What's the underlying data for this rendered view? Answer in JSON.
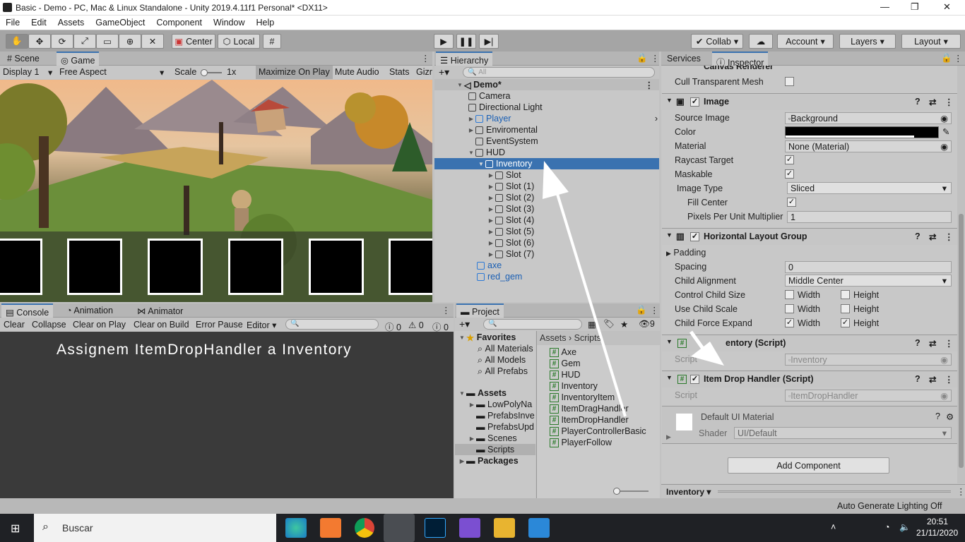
{
  "window": {
    "title": "Basic - Demo - PC, Mac & Linux Standalone - Unity 2019.4.11f1 Personal* <DX11>"
  },
  "menu": [
    "File",
    "Edit",
    "Assets",
    "GameObject",
    "Component",
    "Window",
    "Help"
  ],
  "toolbar": {
    "center": "Center",
    "local": "Local",
    "collab": "Collab",
    "account": "Account",
    "layers": "Layers",
    "layout": "Layout"
  },
  "scene_panel": {
    "tabs": [
      "Scene",
      "Game"
    ],
    "display": "Display 1",
    "aspect": "Free Aspect",
    "scale_label": "Scale",
    "scale_value": "1x",
    "buttons": [
      "Maximize On Play",
      "Mute Audio",
      "Stats",
      "Gizr"
    ]
  },
  "hierarchy": {
    "tab": "Hierarchy",
    "search_placeholder": "All",
    "scene": "Demo*",
    "items": [
      "Camera",
      "Directional Light",
      "Player",
      "Enviromental",
      "EventSystem",
      "HUD",
      "Inventory",
      "Slot",
      "Slot (1)",
      "Slot (2)",
      "Slot (3)",
      "Slot (4)",
      "Slot (5)",
      "Slot (6)",
      "Slot (7)",
      "axe",
      "red_gem"
    ]
  },
  "console": {
    "tabs": [
      "Console",
      "Animation",
      "Animator"
    ],
    "buttons": [
      "Clear",
      "Collapse",
      "Clear on Play",
      "Clear on Build",
      "Error Pause",
      "Editor"
    ],
    "counts": [
      "0",
      "0",
      "0"
    ],
    "message": "Assignem ItemDropHandler a Inventory"
  },
  "project": {
    "tab": "Project",
    "hidden_count": "9",
    "favorites_label": "Favorites",
    "favorites": [
      "All Materials",
      "All Models",
      "All Prefabs"
    ],
    "assets_label": "Assets",
    "assets": [
      "LowPolyNa",
      "PrefabsInve",
      "PrefabsUpd",
      "Scenes",
      "Scripts"
    ],
    "packages": "Packages",
    "breadcrumb": [
      "Assets",
      "Scripts"
    ],
    "scripts": [
      "Axe",
      "Gem",
      "HUD",
      "Inventory",
      "InventoryItem",
      "ItemDragHandler",
      "ItemDropHandler",
      "PlayerControllerBasic",
      "PlayerFollow"
    ]
  },
  "inspector": {
    "tabs": [
      "Services",
      "Inspector"
    ],
    "canvas_renderer": "Canvas Renderer",
    "cull_label": "Cull Transparent Mesh",
    "image": {
      "title": "Image",
      "source_image_label": "Source Image",
      "source_image": "Background",
      "color_label": "Color",
      "material_label": "Material",
      "material": "None (Material)",
      "raycast_label": "Raycast Target",
      "maskable_label": "Maskable",
      "image_type_label": "Image Type",
      "image_type": "Sliced",
      "fill_center_label": "Fill Center",
      "ppu_label": "Pixels Per Unit Multiplier",
      "ppu": "1"
    },
    "hlg": {
      "title": "Horizontal Layout Group",
      "padding": "Padding",
      "spacing_label": "Spacing",
      "spacing": "0",
      "child_align_label": "Child Alignment",
      "child_align": "Middle Center",
      "ccs_label": "Control Child Size",
      "ucs_label": "Use Child Scale",
      "cfe_label": "Child Force Expand",
      "width": "Width",
      "height": "Height"
    },
    "inventory_script": {
      "title": "Inventory (Script)",
      "script_label": "Script",
      "script": "Inventory",
      "title_visible": "entory (Script)"
    },
    "drop_handler": {
      "title": "Item Drop Handler (Script)",
      "script_label": "Script",
      "script": "ItemDropHandler"
    },
    "material": {
      "title": "Default UI Material",
      "shader_label": "Shader",
      "shader": "UI/Default"
    },
    "add_component": "Add Component",
    "footer": "Inventory"
  },
  "status": {
    "right": "Auto Generate Lighting Off"
  },
  "taskbar": {
    "search": "Buscar",
    "time": "20:51",
    "date": "21/11/2020"
  }
}
